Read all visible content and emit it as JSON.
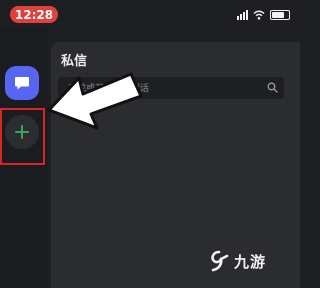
{
  "status_bar": {
    "time": "12:28",
    "time_bg": "#e2403c",
    "icons": [
      "signal-icon",
      "wifi-icon",
      "battery-icon"
    ]
  },
  "rail": {
    "dm_button_color": "#5865f2",
    "dm_icon": "chat-bubble-icon",
    "add_icon": "plus-icon",
    "add_icon_color": "#3ba55d",
    "highlight_color": "#d92526"
  },
  "panel": {
    "title": "私信",
    "search_placeholder": "查找或开始新的对话",
    "search_icon": "search-icon"
  },
  "watermark": {
    "text": "九游"
  }
}
